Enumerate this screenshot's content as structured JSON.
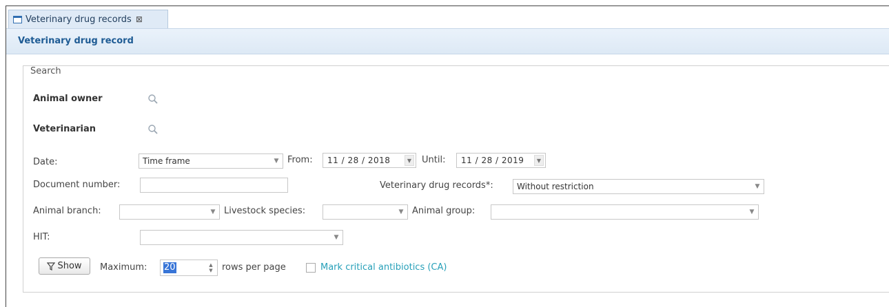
{
  "tab": {
    "label": "Veterinary drug records",
    "close": "⊠"
  },
  "panel": {
    "title": "Veterinary drug record"
  },
  "search": {
    "legend": "Search",
    "animal_owner_label": "Animal owner",
    "veterinarian_label": "Veterinarian",
    "date_label": "Date:",
    "date_type": "Time frame",
    "from_label": "From:",
    "from_value": "11 / 28 / 2018",
    "until_label": "Until:",
    "until_value": "11 / 28 / 2019",
    "document_number_label": "Document number:",
    "document_number_value": "",
    "vdr_label": "Veterinary drug records*:",
    "vdr_value": "Without restriction",
    "animal_branch_label": "Animal branch:",
    "animal_branch_value": "",
    "livestock_species_label": "Livestock species:",
    "livestock_species_value": "",
    "animal_group_label": "Animal group:",
    "animal_group_value": "",
    "hit_label": "HIT:",
    "hit_value": ""
  },
  "footer": {
    "show_label": "Show",
    "maximum_label": "Maximum:",
    "maximum_value": "20",
    "rows_label": "rows per page",
    "critical_label": "Mark critical antibiotics (CA)",
    "critical_checked": false
  },
  "icons": [
    "tab-window-icon",
    "close-icon",
    "search-icon",
    "dropdown-arrow-icon",
    "filter-icon",
    "spinner-icon"
  ],
  "colors": {
    "title": "#1e5b94",
    "link": "#27a0b9",
    "selection": "#3875d7",
    "tab_bg": "#dfeaf6"
  }
}
